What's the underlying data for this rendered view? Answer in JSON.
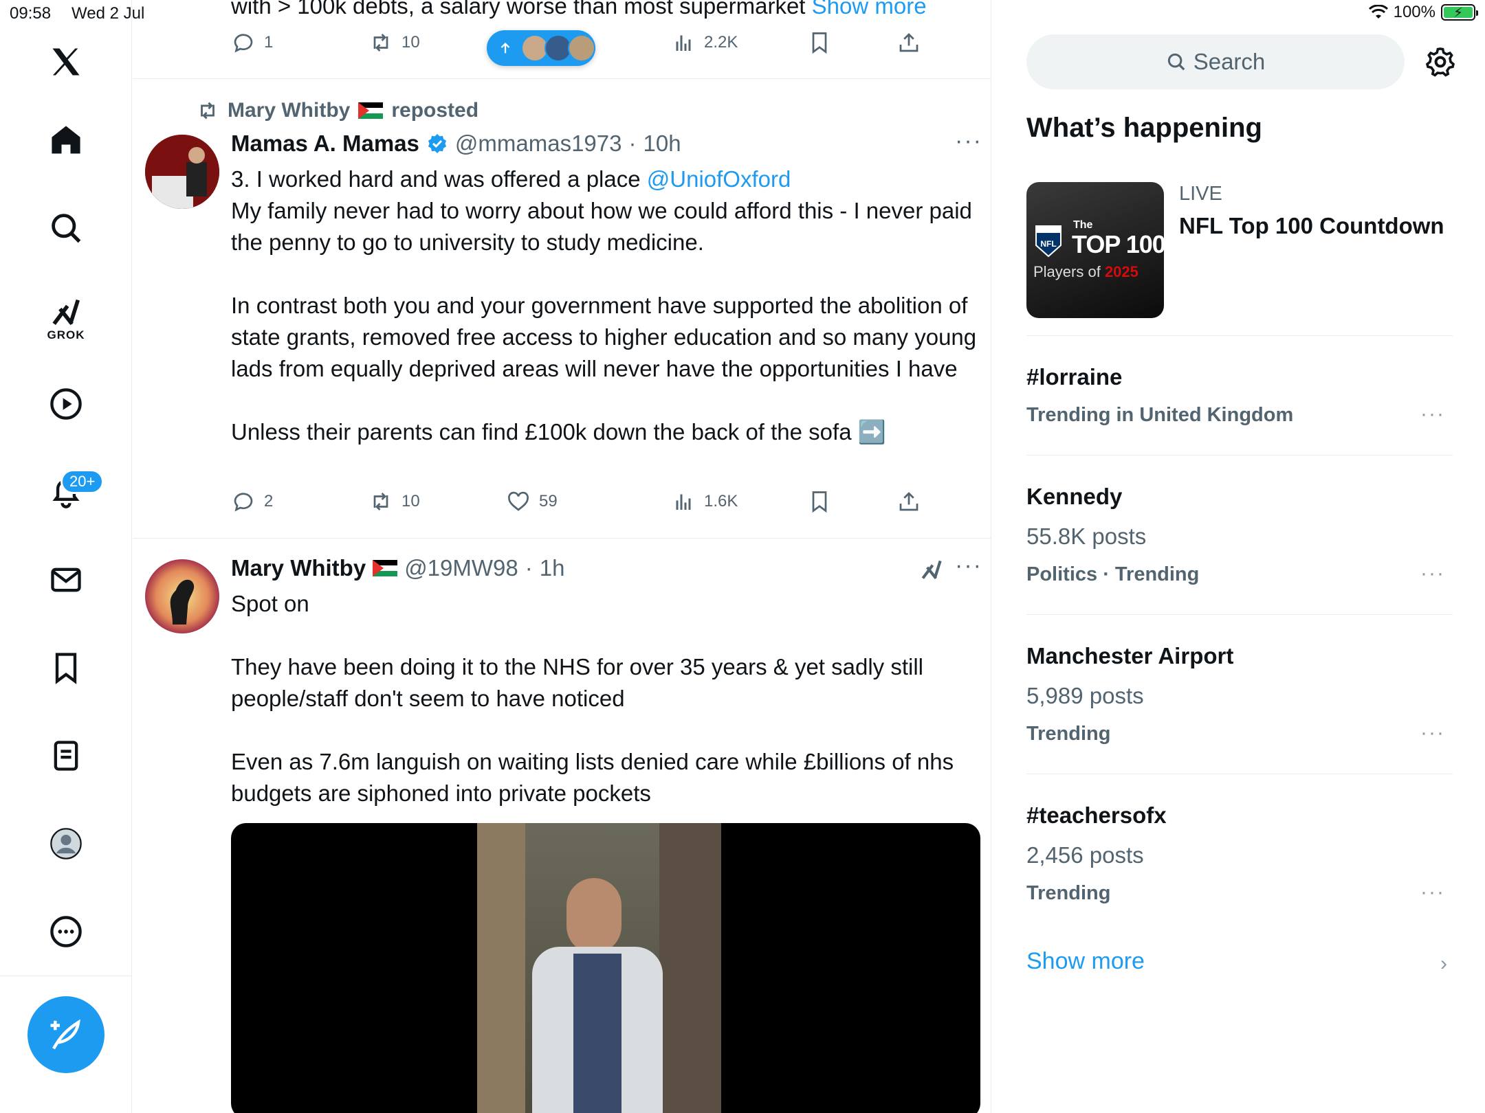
{
  "status_bar": {
    "time": "09:58",
    "date": "Wed 2 Jul",
    "battery": "100%"
  },
  "nav": {
    "grok_label": "GROK",
    "notifications_badge": "20+"
  },
  "feed": {
    "top_tweet_partial": {
      "text": "with > 100k debts, a salary worse than most supermarket ",
      "show_more": "Show more",
      "replies": "1",
      "reposts": "10",
      "views": "2.2K"
    },
    "tweet1": {
      "repost_by": "Mary Whitby",
      "repost_suffix": "reposted",
      "author_name": "Mamas A. Mamas",
      "handle": "@mmamas1973",
      "time": "10h",
      "text_1": "3. I worked hard and was offered a place ",
      "mention": "@UniofOxford",
      "text_2": "My family never had to worry about how we could afford this - I never paid the penny to go to university to study medicine.\n\nIn contrast both you and your government have supported the abolition of state grants, removed free access to higher education and so many young lads from equally deprived areas will never have the opportunities I have\n\nUnless their parents can find £100k down the back of the sofa ➡️",
      "replies": "2",
      "reposts": "10",
      "likes": "59",
      "views": "1.6K"
    },
    "tweet2": {
      "author_name": "Mary Whitby",
      "handle": "@19MW98",
      "time": "1h",
      "text": "Spot on\n\nThey have been doing it to the NHS for over 35 years & yet sadly still people/staff don't seem to have noticed\n\nEven as 7.6m languish on waiting lists denied care while £billions of nhs budgets are siphoned into private pockets"
    }
  },
  "sidebar": {
    "search_placeholder": "Search",
    "section_title": "What’s happening",
    "trends": [
      {
        "context": "LIVE",
        "title": "NFL Top 100 Countdown",
        "thumb_line1": "The",
        "thumb_line2": "TOP 100",
        "thumb_line3": "Players of ",
        "thumb_year": "2025"
      },
      {
        "title": "#lorraine",
        "meta": "Trending in United Kingdom"
      },
      {
        "title": "Kennedy",
        "posts": "55.8K posts",
        "meta": "Politics · Trending"
      },
      {
        "title": "Manchester Airport",
        "posts": "5,989 posts",
        "meta": "Trending"
      },
      {
        "title": "#teachersofx",
        "posts": "2,456 posts",
        "meta": "Trending"
      }
    ],
    "show_more": "Show more"
  },
  "colors": {
    "accent": "#1d9bf0",
    "text": "#0f1419",
    "secondary": "#536471"
  }
}
